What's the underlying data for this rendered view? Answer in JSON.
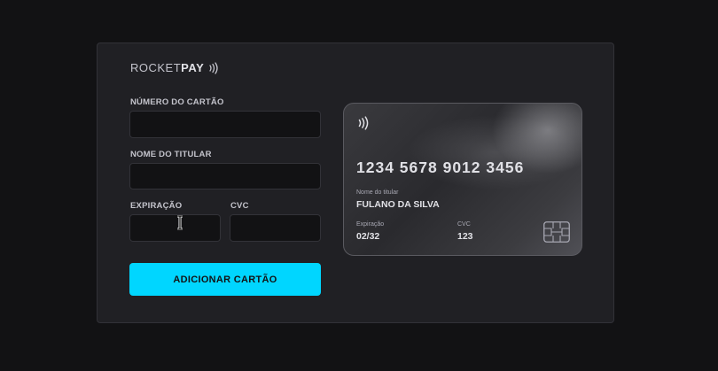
{
  "brand": {
    "name_light": "ROCKET",
    "name_bold": "PAY",
    "icon": "contactless-icon"
  },
  "form": {
    "card_number": {
      "label": "NÚMERO DO CARTÃO",
      "value": "",
      "placeholder": ""
    },
    "holder_name": {
      "label": "NOME DO TITULAR",
      "value": "",
      "placeholder": ""
    },
    "expiration": {
      "label": "EXPIRAÇÃO",
      "value": "",
      "placeholder": ""
    },
    "cvc": {
      "label": "CVC",
      "value": "",
      "placeholder": ""
    },
    "submit_label": "ADICIONAR CARTÃO"
  },
  "card_preview": {
    "number": "1234 5678 9012 3456",
    "holder_label": "Nome do titular",
    "holder_value": "FULANO DA SILVA",
    "expiration_label": "Expiração",
    "expiration_value": "02/32",
    "cvc_label": "CVC",
    "cvc_value": "123",
    "icons": [
      "contactless-icon",
      "chip-icon"
    ]
  },
  "colors": {
    "background": "#121214",
    "panel": "#202024",
    "accent": "#00d6ff",
    "text": "#e1e1e6"
  }
}
